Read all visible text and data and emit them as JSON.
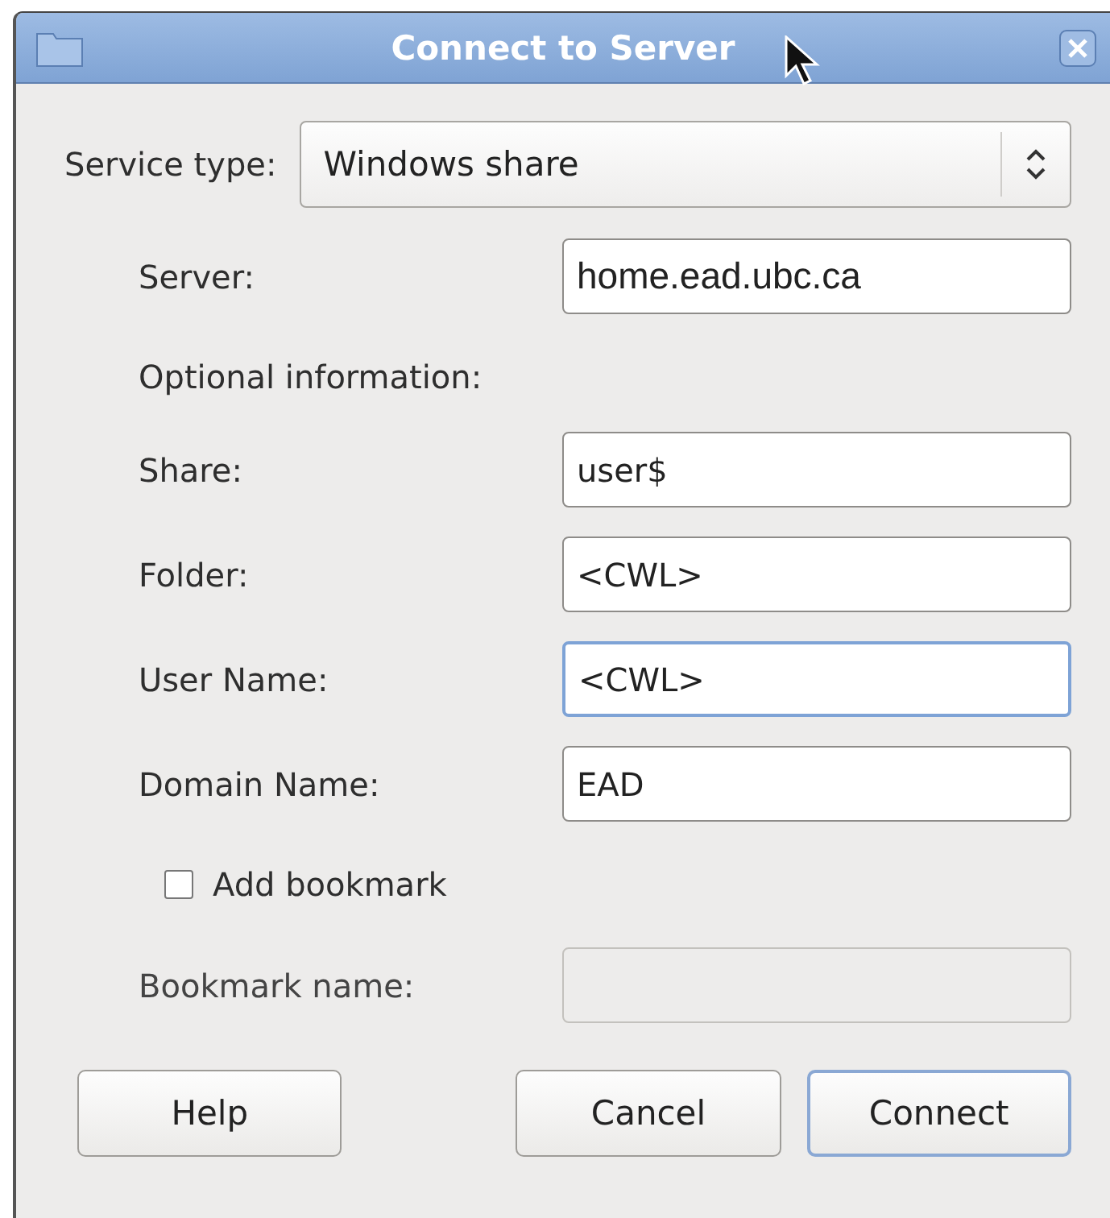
{
  "window": {
    "title": "Connect to Server"
  },
  "service_type": {
    "label": "Service type:",
    "value": "Windows share"
  },
  "server": {
    "label": "Server:",
    "value": "home.ead.ubc.ca",
    "focused": false
  },
  "optional_heading": "Optional information:",
  "fields": [
    {
      "label": "Share:",
      "value": "user$",
      "focused": false
    },
    {
      "label": "Folder:",
      "value": "<CWL>",
      "focused": false
    },
    {
      "label": "User Name:",
      "value": "<CWL>",
      "focused": true
    },
    {
      "label": "Domain Name:",
      "value": "EAD",
      "focused": false
    }
  ],
  "bookmark": {
    "label": "Add bookmark",
    "checked": false
  },
  "bookmark_name": {
    "label": "Bookmark name:",
    "disabled": true
  },
  "buttons": [
    {
      "label": "Help",
      "default": false
    },
    {
      "label": "Cancel",
      "default": false
    },
    {
      "label": "Connect",
      "default": true
    }
  ]
}
